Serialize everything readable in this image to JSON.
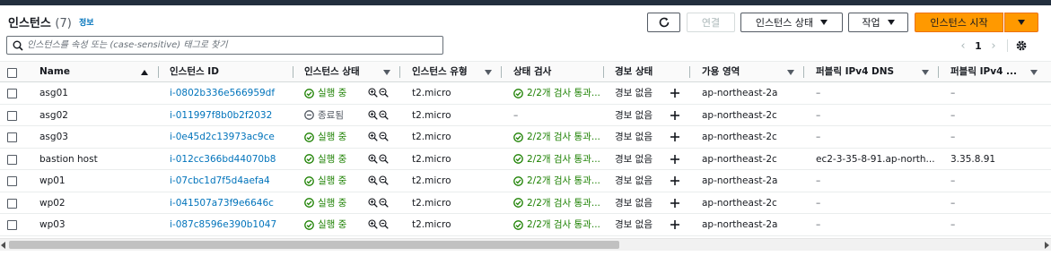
{
  "header": {
    "title": "인스턴스",
    "count": "(7)",
    "info_link": "정보",
    "refresh_icon": "refresh-icon",
    "connect_label": "연결",
    "instance_state_label": "인스턴스 상태",
    "actions_label": "작업",
    "launch_label": "인스턴스 시작"
  },
  "search": {
    "placeholder": "인스턴스를 속성 또는 (case-sensitive) 태그로 찾기"
  },
  "pagination": {
    "page": "1"
  },
  "columns": [
    "Name",
    "인스턴스 ID",
    "인스턴스 상태",
    "인스턴스 유형",
    "상태 검사",
    "경보 상태",
    "가용 영역",
    "퍼블릭 IPv4 DNS",
    "퍼블릭 IPv4 ..."
  ],
  "rows": [
    {
      "name": "asg01",
      "id": "i-0802b336e566959df",
      "state": "실행 중",
      "running": true,
      "type": "t2.micro",
      "check": "2/2개 검사 통과...",
      "alarm": "경보 없음",
      "az": "ap-northeast-2a",
      "dns": "–",
      "ipv4": "–"
    },
    {
      "name": "asg02",
      "id": "i-011997f8b0b2f2032",
      "state": "종료됨",
      "running": false,
      "type": "t2.micro",
      "check": "–",
      "alarm": "경보 없음",
      "az": "ap-northeast-2c",
      "dns": "–",
      "ipv4": "–"
    },
    {
      "name": "asg03",
      "id": "i-0e45d2c13973ac9ce",
      "state": "실행 중",
      "running": true,
      "type": "t2.micro",
      "check": "2/2개 검사 통과...",
      "alarm": "경보 없음",
      "az": "ap-northeast-2c",
      "dns": "–",
      "ipv4": "–"
    },
    {
      "name": "bastion host",
      "id": "i-012cc366bd44070b8",
      "state": "실행 중",
      "running": true,
      "type": "t2.micro",
      "check": "2/2개 검사 통과...",
      "alarm": "경보 없음",
      "az": "ap-northeast-2c",
      "dns": "ec2-3-35-8-91.ap-north...",
      "ipv4": "3.35.8.91"
    },
    {
      "name": "wp01",
      "id": "i-07cbc1d7f5d4aefa4",
      "state": "실행 중",
      "running": true,
      "type": "t2.micro",
      "check": "2/2개 검사 통과...",
      "alarm": "경보 없음",
      "az": "ap-northeast-2a",
      "dns": "–",
      "ipv4": "–"
    },
    {
      "name": "wp02",
      "id": "i-041507a73f9e6646c",
      "state": "실행 중",
      "running": true,
      "type": "t2.micro",
      "check": "2/2개 검사 통과...",
      "alarm": "경보 없음",
      "az": "ap-northeast-2c",
      "dns": "–",
      "ipv4": "–"
    },
    {
      "name": "wp03",
      "id": "i-087c8596e390b1047",
      "state": "실행 중",
      "running": true,
      "type": "t2.micro",
      "check": "2/2개 검사 통과...",
      "alarm": "경보 없음",
      "az": "ap-northeast-2a",
      "dns": "–",
      "ipv4": "–"
    }
  ],
  "colors": {
    "accent": "#ff9900",
    "link": "#0073bb",
    "success": "#1d8102",
    "muted": "#545b64"
  }
}
